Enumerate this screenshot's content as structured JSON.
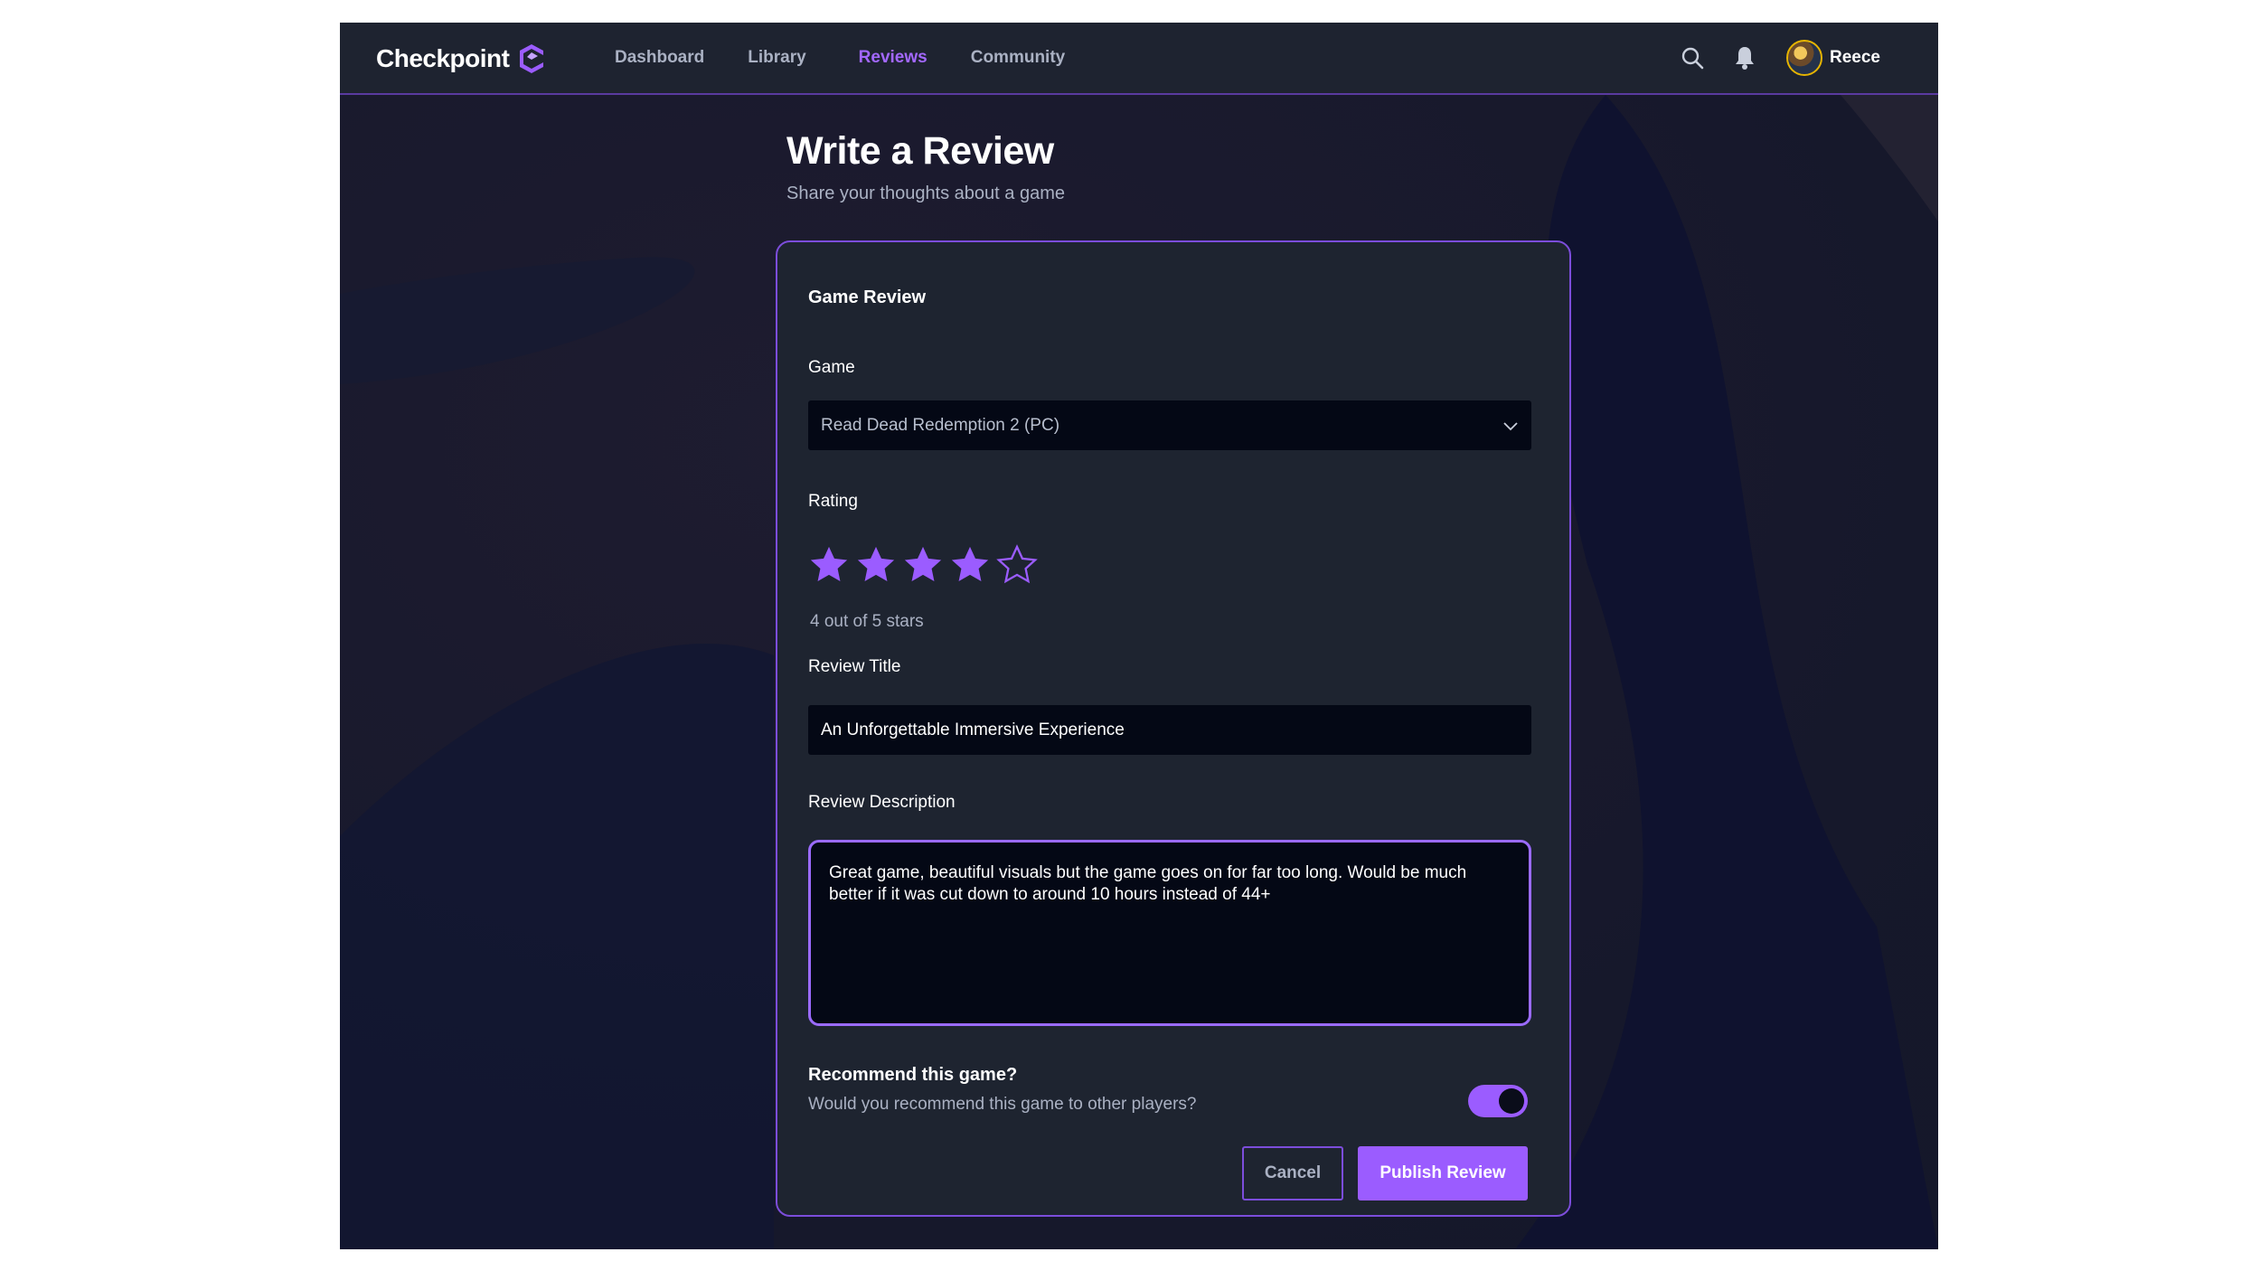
{
  "app": {
    "brand": "Checkpoint",
    "colors": {
      "accent": "#9b5cff",
      "background": "#121726",
      "card": "#1e2430",
      "input": "#040815"
    }
  },
  "nav": {
    "items": [
      {
        "label": "Dashboard",
        "active": false
      },
      {
        "label": "Library",
        "active": false
      },
      {
        "label": "Reviews",
        "active": true
      },
      {
        "label": "Community",
        "active": false
      }
    ]
  },
  "header_icons": {
    "search": "search-icon",
    "notifications": "bell-icon"
  },
  "user": {
    "name": "Reece"
  },
  "page": {
    "title": "Write a Review",
    "subtitle": "Share your thoughts about a game"
  },
  "form": {
    "card_title": "Game Review",
    "game": {
      "label": "Game",
      "value": "Read Dead Redemption 2 (PC)"
    },
    "rating": {
      "label": "Rating",
      "value": 4,
      "max": 5,
      "text": "4 out of 5 stars"
    },
    "review_title": {
      "label": "Review Title",
      "value": "An Unforgettable Immersive Experience"
    },
    "review_description": {
      "label": "Review Description",
      "value": "Great game, beautiful visuals but the game goes on for far too long. Would be much better if it was cut down to around 10 hours instead of 44+"
    },
    "recommend": {
      "title": "Recommend this game?",
      "subtitle": "Would you recommend this game to other players?",
      "on": true
    },
    "cancel_label": "Cancel",
    "publish_label": "Publish Review"
  }
}
